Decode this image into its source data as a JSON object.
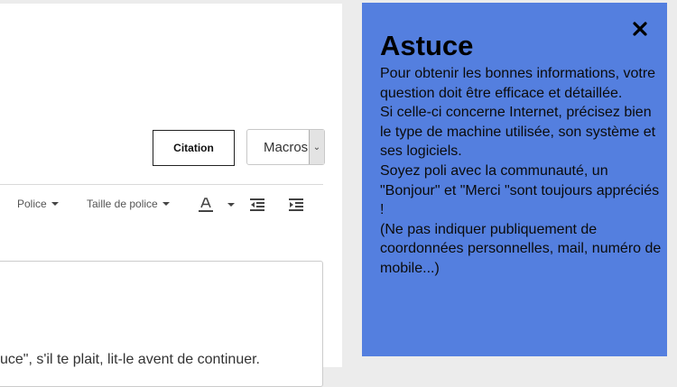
{
  "editor": {
    "citation_label": "Citation",
    "macros_label": "Macros",
    "toolbar": {
      "font_label": "Police",
      "font_size_label": "Taille de police"
    },
    "body_text": "uce\", s'il te plait, lit-le avent de continuer."
  },
  "tip": {
    "title": "Astuce",
    "lines": [
      "Pour obtenir les bonnes informations, votre question doit être efficace et détaillée.",
      "Si celle-ci concerne Internet, précisez bien le type de machine utilisée, son système et ses logiciels.",
      "Soyez poli avec la communauté, un \"Bonjour\" et \"Merci \"sont toujours appréciés !",
      "(Ne pas indiquer publiquement de coordonnées personnelles, mail, numéro de mobile...)"
    ],
    "close_icon": "close-icon"
  },
  "colors": {
    "tip_background": "#547fdf",
    "page_background": "#ececec"
  }
}
